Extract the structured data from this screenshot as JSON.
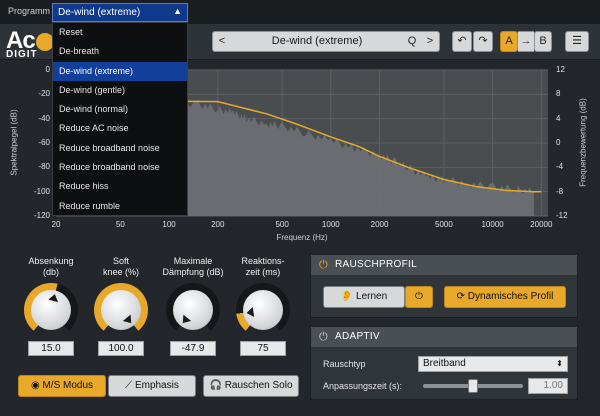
{
  "program": {
    "label": "Programm",
    "selected": "De-wind (extreme)"
  },
  "dropdown": {
    "items": [
      "Reset",
      "De-breath",
      "De-wind (extreme)",
      "De-wind (gentle)",
      "De-wind (normal)",
      "Reduce AC noise",
      "Reduce broadband noise",
      "Reduce broadband noise",
      "Reduce hiss",
      "Reduce rumble"
    ],
    "selected_index": 2
  },
  "header": {
    "logo": "Ac",
    "logo_sub": "DIGIT",
    "preset_prev": "<",
    "preset_name": "De-wind (extreme)",
    "preset_search": "Q",
    "preset_next": ">",
    "undo": "↶",
    "redo": "↷",
    "ab_a": "A",
    "ab_arrow": "→",
    "ab_b": "B",
    "menu": "☰"
  },
  "chart_data": {
    "type": "area",
    "y_left_label": "Spektralpegel (dB)",
    "y_right_label": "Frequenzbewertung (dB)",
    "x_label": "Frequenz (Hz)",
    "x_ticks": [
      "20",
      "50",
      "100",
      "200",
      "500",
      "1000",
      "2000",
      "5000",
      "10000",
      "20000"
    ],
    "x_tick_values": [
      20,
      50,
      100,
      200,
      500,
      1000,
      2000,
      5000,
      10000,
      20000
    ],
    "y_left_ticks": [
      "0",
      "-20",
      "-40",
      "-60",
      "-80",
      "-100",
      "-120"
    ],
    "y_left_values": [
      0,
      -20,
      -40,
      -60,
      -80,
      -100,
      -120
    ],
    "y_right_ticks": [
      "12",
      "8",
      "4",
      "0",
      "-4",
      "-8",
      "-12"
    ],
    "ylim_left": [
      -120,
      0
    ],
    "xlim": [
      20,
      22000
    ],
    "spectrum": {
      "x": [
        20,
        100,
        150,
        200,
        250,
        300,
        400,
        500,
        700,
        1000,
        1400,
        2000,
        2500,
        3000,
        4000,
        5000,
        7000,
        10000,
        14000,
        18000
      ],
      "y": [
        -25,
        -25,
        -28,
        -32,
        -35,
        -40,
        -44,
        -46,
        -52,
        -58,
        -64,
        -70,
        -75,
        -80,
        -88,
        -90,
        -93,
        -96,
        -98,
        -100
      ]
    },
    "curve": {
      "name": "",
      "x": [
        20,
        200,
        400,
        600,
        1000,
        1500,
        2000,
        3000,
        5000,
        8000,
        12000,
        18000,
        20000
      ],
      "y": [
        -25,
        -26,
        -36,
        -44,
        -55,
        -63,
        -71,
        -80,
        -90,
        -96,
        -99,
        -100,
        -100
      ]
    },
    "colors": {
      "spectrum": "#6d7073",
      "curve": "#e8a82a"
    }
  },
  "knobs": [
    {
      "label": "Absenkung\n(db)",
      "value": "15.0",
      "level": 0.55
    },
    {
      "label": "Soft\nknee (%)",
      "value": "100.0",
      "level": 1.0
    },
    {
      "label": "Maximale\nDämpfung (dB)",
      "value": "-47.9",
      "level": 0.0
    },
    {
      "label": "Reaktions-\nzeit (ms)",
      "value": "75",
      "level": 0.15
    }
  ],
  "bottom_buttons": {
    "ms": "M/S Modus",
    "emphasis": "Emphasis",
    "solo": "Rauschen Solo"
  },
  "noise_profile": {
    "title": "RAUSCHPROFIL",
    "learn": "Lernen",
    "dynamic": "Dynamisches Profil"
  },
  "adaptive": {
    "title": "ADAPTIV",
    "noise_type_label": "Rauschtyp",
    "noise_type_value": "Breitband",
    "adapt_label": "Anpassungszeit (s):",
    "adapt_value": "1.00",
    "adapt_level": 0.5
  },
  "colors": {
    "accent": "#e8a82a",
    "selected": "#123f9a"
  }
}
